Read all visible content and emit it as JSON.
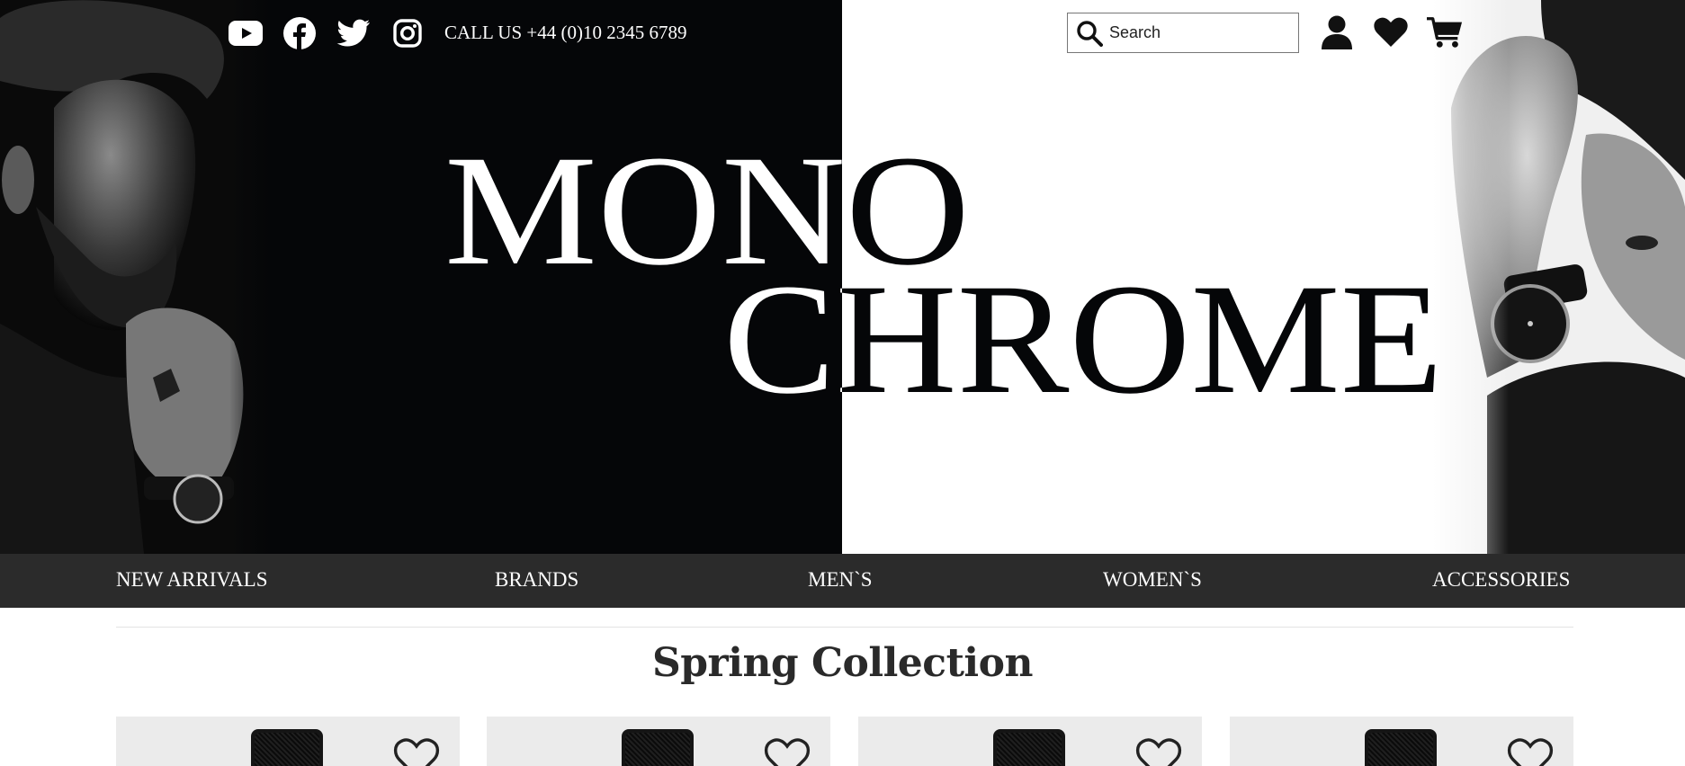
{
  "topbar": {
    "social": [
      {
        "name": "youtube-icon"
      },
      {
        "name": "facebook-icon"
      },
      {
        "name": "twitter-icon"
      },
      {
        "name": "instagram-icon"
      }
    ],
    "call_text": "CALL US +44 (0)10 2345 6789",
    "search": {
      "placeholder": "Search",
      "value": ""
    },
    "icons": [
      "user-icon",
      "heart-icon",
      "cart-icon"
    ]
  },
  "hero": {
    "title_line1": "MONO",
    "title_line2": "CHROME"
  },
  "nav": {
    "items": [
      {
        "label": "NEW ARRIVALS"
      },
      {
        "label": "BRANDS"
      },
      {
        "label": "MEN`S"
      },
      {
        "label": "WOMEN`S"
      },
      {
        "label": "ACCESSORIES"
      }
    ]
  },
  "collection": {
    "title": "Spring Collection",
    "card_icon": "heart-outline-icon"
  },
  "colors": {
    "hero_dark": "#050608",
    "hero_light": "#ffffff",
    "nav_bg": "#2b2b2b",
    "card_bg": "#ebebeb"
  }
}
